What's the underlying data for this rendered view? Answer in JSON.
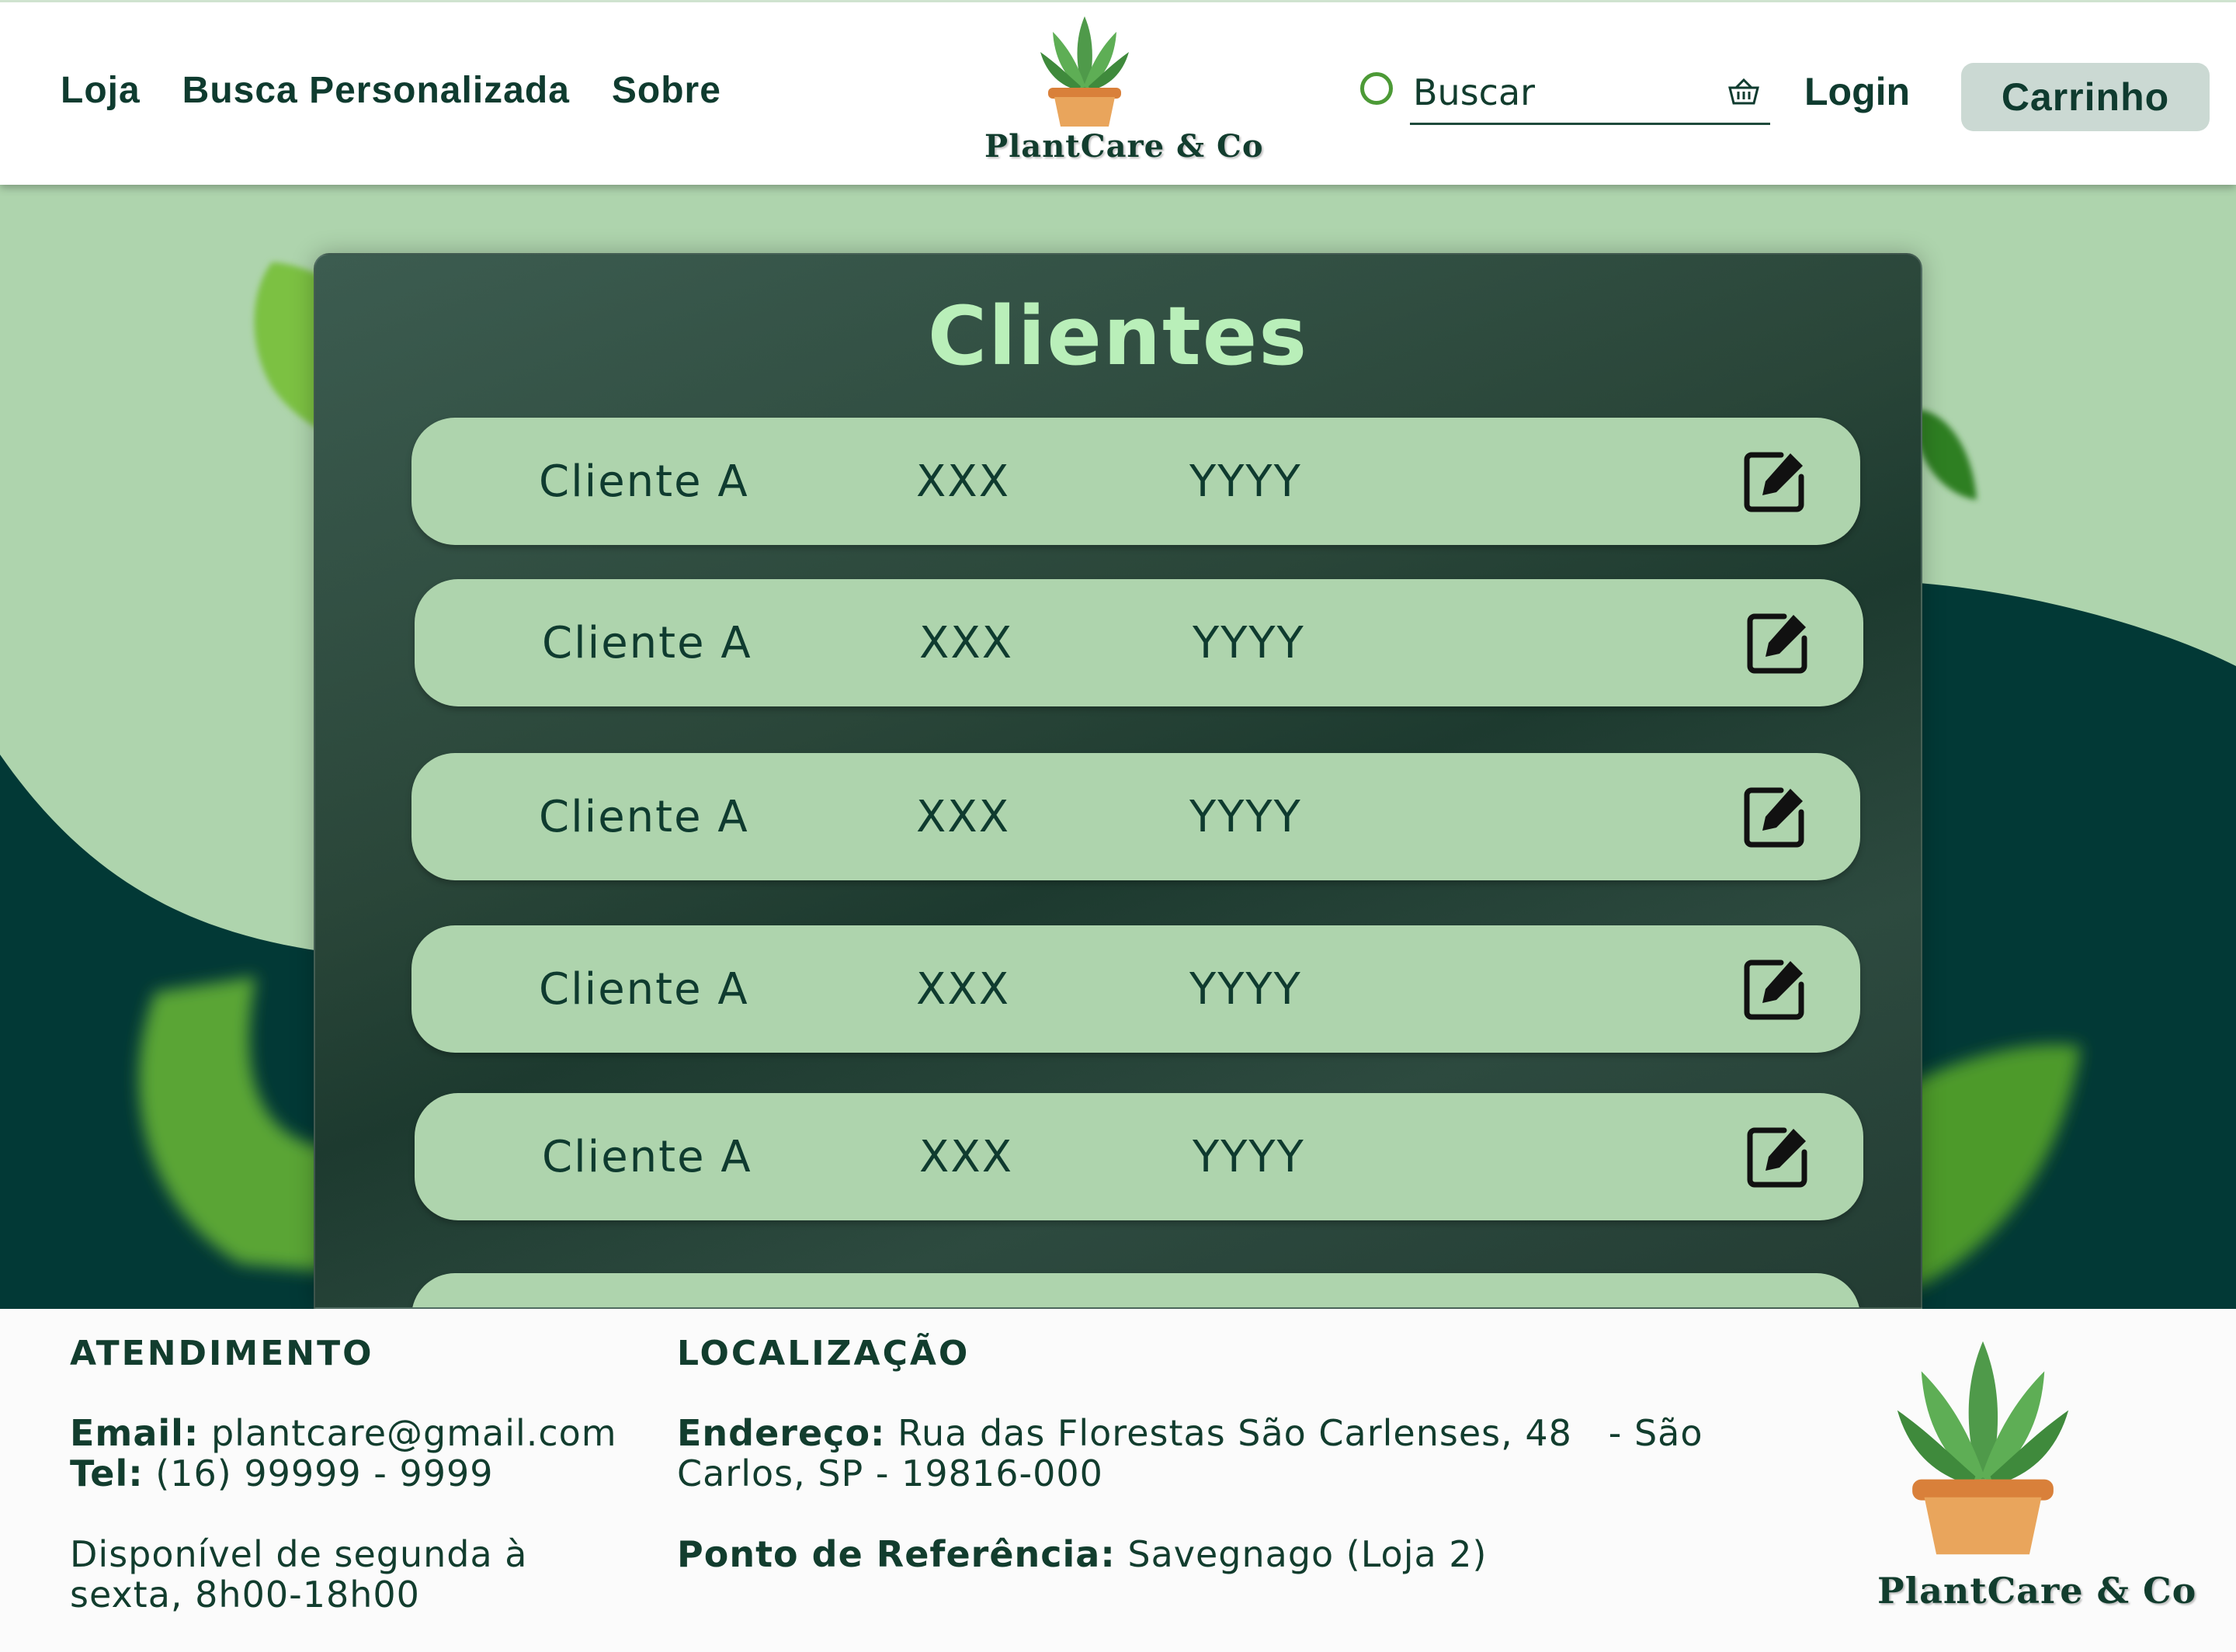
{
  "nav": {
    "items": [
      "Loja",
      "Busca Personalizada",
      "Sobre"
    ]
  },
  "brand": {
    "name": "PlantCare & Co"
  },
  "search": {
    "placeholder": "Buscar"
  },
  "header": {
    "login_label": "Login",
    "cart_label": "Carrinho"
  },
  "main": {
    "title": "Clientes",
    "clients": [
      {
        "name": "Cliente A",
        "col2": "XXX",
        "col3": "YYYY"
      },
      {
        "name": "Cliente A",
        "col2": "XXX",
        "col3": "YYYY"
      },
      {
        "name": "Cliente A",
        "col2": "XXX",
        "col3": "YYYY"
      },
      {
        "name": "Cliente A",
        "col2": "XXX",
        "col3": "YYYY"
      },
      {
        "name": "Cliente A",
        "col2": "XXX",
        "col3": "YYYY"
      }
    ]
  },
  "footer": {
    "atendimento": {
      "heading": "ATENDIMENTO",
      "email_label": "Email:",
      "email": "plantcare@gmail.com",
      "tel_label": "Tel:",
      "tel": "(16) 99999 - 9999",
      "hours_line1": "Disponível de segunda à",
      "hours_line2": "sexta, 8h00-18h00"
    },
    "localizacao": {
      "heading": "LOCALIZAÇÃO",
      "address_label": "Endereço:",
      "address_line1": "Rua das Florestas São Carlenses, 48   - São",
      "address_line2": "Carlos, SP - 19816-000",
      "reference_label": "Ponto de Referência:",
      "reference": "Savegnago (Loja 2)"
    }
  },
  "colors": {
    "dark_green": "#0f3b2f",
    "light_green": "#aed4ad",
    "deep_teal": "#023936",
    "title_green": "#b9efb9"
  },
  "icons": [
    "leaf-plant-icon",
    "basket-icon",
    "edit-icon"
  ]
}
